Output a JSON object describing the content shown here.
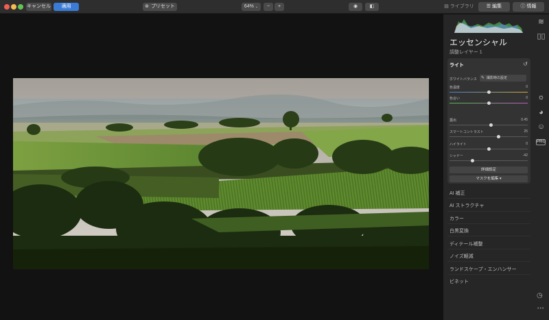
{
  "toolbar": {
    "cancel_label": "キャンセル",
    "apply_label": "適用",
    "presets_label": "プリセット",
    "zoom_value": "64%",
    "zoom_out_label": "−",
    "zoom_in_label": "+"
  },
  "tabs": [
    {
      "label": "ライブラリ"
    },
    {
      "label": "編集"
    },
    {
      "label": "情報"
    }
  ],
  "panel": {
    "title": "エッセンシャル",
    "layer_name": "調整レイヤー 1",
    "card": {
      "title": "ライト",
      "white_balance_label": "ホワイトバランス",
      "white_balance_value": "撮影時の設定",
      "sliders": [
        {
          "label": "色温度",
          "value": "0",
          "fraction": 0.5
        },
        {
          "label": "色合い",
          "value": "0",
          "fraction": 0.5
        },
        {
          "label": "露出",
          "value": "0.45",
          "fraction": 0.53
        },
        {
          "label": "スマートコントラスト",
          "value": "25",
          "fraction": 0.625
        },
        {
          "label": "ハイライト",
          "value": "0",
          "fraction": 0.5
        },
        {
          "label": "シャドー",
          "value": "-42",
          "fraction": 0.29
        }
      ],
      "advanced_label": "詳細設定",
      "mask_label": "マスクを編集 ▾"
    },
    "sections": [
      {
        "label": "AI 補正"
      },
      {
        "label": "AI ストラクチャ"
      },
      {
        "label": "カラー"
      },
      {
        "label": "白黒変換"
      },
      {
        "label": "ディテール補整"
      },
      {
        "label": "ノイズ軽減"
      },
      {
        "label": "ランドスケープ・エンハンサー"
      },
      {
        "label": "ビネット"
      }
    ]
  },
  "sidebar_icons": [
    "layers-icon",
    "compare-icon",
    "sun-icon",
    "palette-icon",
    "face-icon",
    "pro-badge"
  ],
  "pro_label": "PRO",
  "colors": {
    "accent": "#3a7bd5",
    "panel": "#262626",
    "card": "#333333"
  }
}
